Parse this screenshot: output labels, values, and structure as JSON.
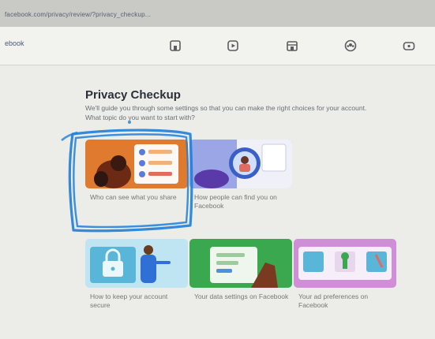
{
  "browser": {
    "url": "facebook.com/privacy/review/?privacy_checkup..."
  },
  "navbar": {
    "search_text": "ebook",
    "icons": [
      "home-icon",
      "watch-icon",
      "marketplace-icon",
      "groups-icon",
      "gaming-icon"
    ]
  },
  "privacy": {
    "title": "Privacy Checkup",
    "description_line1": "We'll guide you through some settings so that you can make the right choices for your account.",
    "description_line2": "What topic do you want to start with?"
  },
  "topics": [
    {
      "label": "Who can see what you share",
      "color": "#e07a2e"
    },
    {
      "label": "How people can find you on Facebook",
      "color": "#9aa6e6"
    },
    {
      "label": "How to keep your account secure",
      "color": "#5ab6d8"
    },
    {
      "label": "Your data settings on Facebook",
      "color": "#3aa84e"
    },
    {
      "label": "Your ad preferences on Facebook",
      "color": "#cf8fd6"
    }
  ],
  "accent_colors": {
    "pen_highlight": "#1f7fd8"
  }
}
